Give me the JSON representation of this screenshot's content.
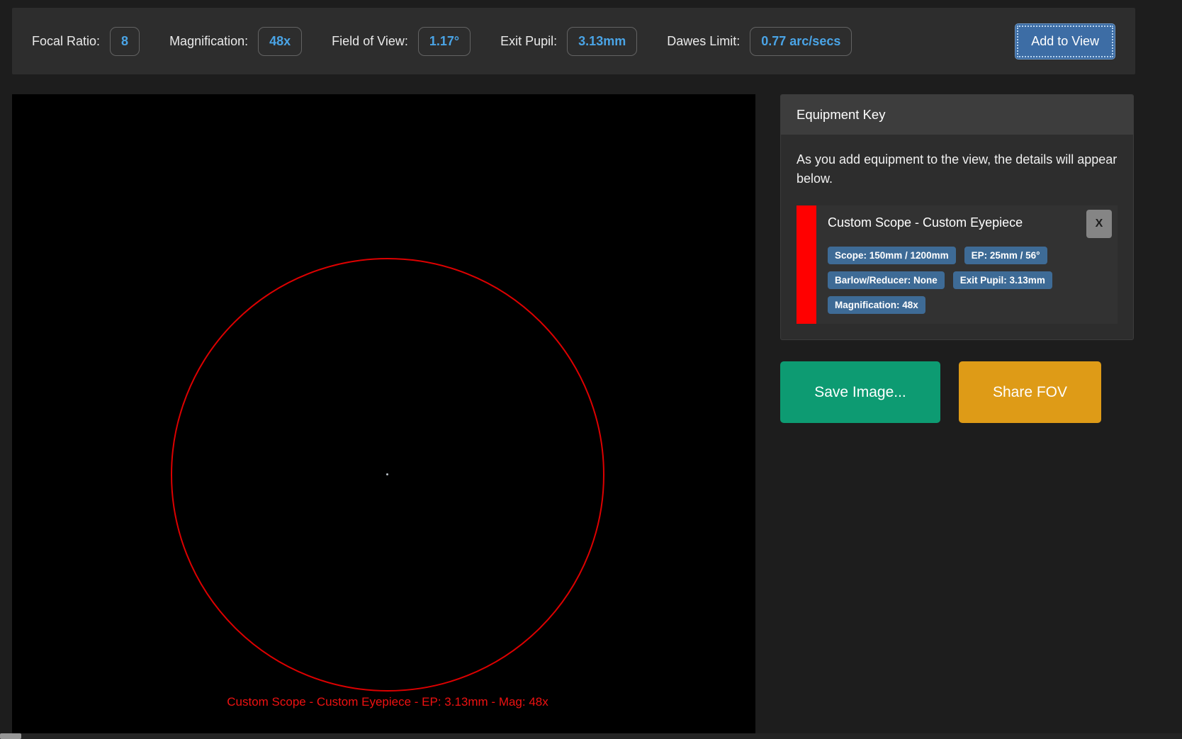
{
  "stats_bar": {
    "items": [
      {
        "label": "Focal Ratio:",
        "value": "8"
      },
      {
        "label": "Magnification:",
        "value": "48x"
      },
      {
        "label": "Field of View:",
        "value": "1.17°"
      },
      {
        "label": "Exit Pupil:",
        "value": "3.13mm"
      },
      {
        "label": "Dawes Limit:",
        "value": "0.77 arc/secs"
      }
    ],
    "add_button_label": "Add to View"
  },
  "view": {
    "caption": "Custom Scope - Custom Eyepiece - EP: 3.13mm - Mag: 48x"
  },
  "equipment_key": {
    "title": "Equipment Key",
    "description": "As you add equipment to the view, the details will appear below.",
    "items": [
      {
        "name": "Custom Scope - Custom Eyepiece",
        "swatch_color": "#ff0000",
        "remove_label": "X",
        "badges": [
          "Scope: 150mm / 1200mm",
          "EP: 25mm / 56°",
          "Barlow/Reducer: None",
          "Exit Pupil: 3.13mm",
          "Magnification: 48x"
        ]
      }
    ]
  },
  "actions": {
    "save_image_label": "Save Image...",
    "share_fov_label": "Share FOV"
  },
  "colors": {
    "accent_blue": "#4aa4e6",
    "badge_blue": "#3e6b96",
    "button_blue": "#3d6da5",
    "save_green": "#0d9b72",
    "share_orange": "#de9b17",
    "fov_red": "#ff0000"
  }
}
